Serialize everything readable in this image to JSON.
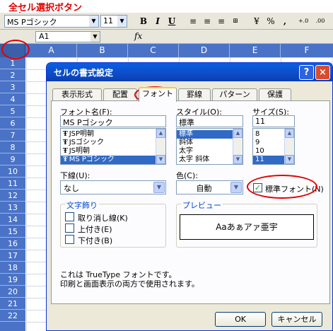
{
  "annotation": {
    "select_all_label": "全セル選択ボタン",
    "color": "#e00000"
  },
  "toolbar": {
    "font_name": "MS Pゴシック",
    "font_size": "11",
    "bold": "B",
    "italic": "I",
    "underline": "U",
    "icons": [
      "align-left-icon",
      "align-center-icon",
      "align-right-icon",
      "merge-center-icon",
      "currency-icon",
      "percent-icon",
      "comma-style-icon",
      "increase-decimal-icon"
    ]
  },
  "formula_bar": {
    "name_box": "A1",
    "fx": "fx"
  },
  "sheet": {
    "columns": [
      "A",
      "B",
      "C",
      "D",
      "E",
      "F"
    ],
    "rows": [
      "1",
      "2",
      "3",
      "4",
      "5",
      "6",
      "7",
      "8",
      "9",
      "10",
      "11",
      "12",
      "13",
      "14",
      "15",
      "16",
      "17",
      "18",
      "19",
      "20",
      "21",
      "22"
    ],
    "header_color": "#4a73c7"
  },
  "dialog": {
    "title": "セルの書式設定",
    "help": "?",
    "close": "×",
    "tabs": [
      "表示形式",
      "配置",
      "フォント",
      "罫線",
      "パターン",
      "保護"
    ],
    "active_tab": "フォント",
    "font_name_label": "フォント名(F):",
    "font_name_value": "MS Pゴシック",
    "font_list": [
      "JSP明朝",
      "JSゴシック",
      "JS明朝",
      "MS Pゴシック"
    ],
    "style_label": "スタイル(O):",
    "style_value": "標準",
    "style_list": [
      "標準",
      "斜体",
      "太字",
      "太字 斜体"
    ],
    "size_label": "サイズ(S):",
    "size_value": "11",
    "size_list": [
      "8",
      "9",
      "10",
      "11"
    ],
    "underline_label": "下線(U):",
    "underline_value": "なし",
    "color_label": "色(C):",
    "color_value": "自動",
    "normal_font_label": "標準フォント(N)",
    "normal_font_checked": true,
    "effects_label": "文字飾り",
    "strikethrough_label": "取り消し線(K)",
    "superscript_label": "上付き(E)",
    "subscript_label": "下付き(B)",
    "preview_label": "プレビュー",
    "preview_text": "Aaあぁアァ亜宇",
    "info_line1": "これは TrueType フォントです。",
    "info_line2": "印刷と画面表示の両方で使用されます。",
    "ok_label": "OK",
    "cancel_label": "キャンセル"
  }
}
